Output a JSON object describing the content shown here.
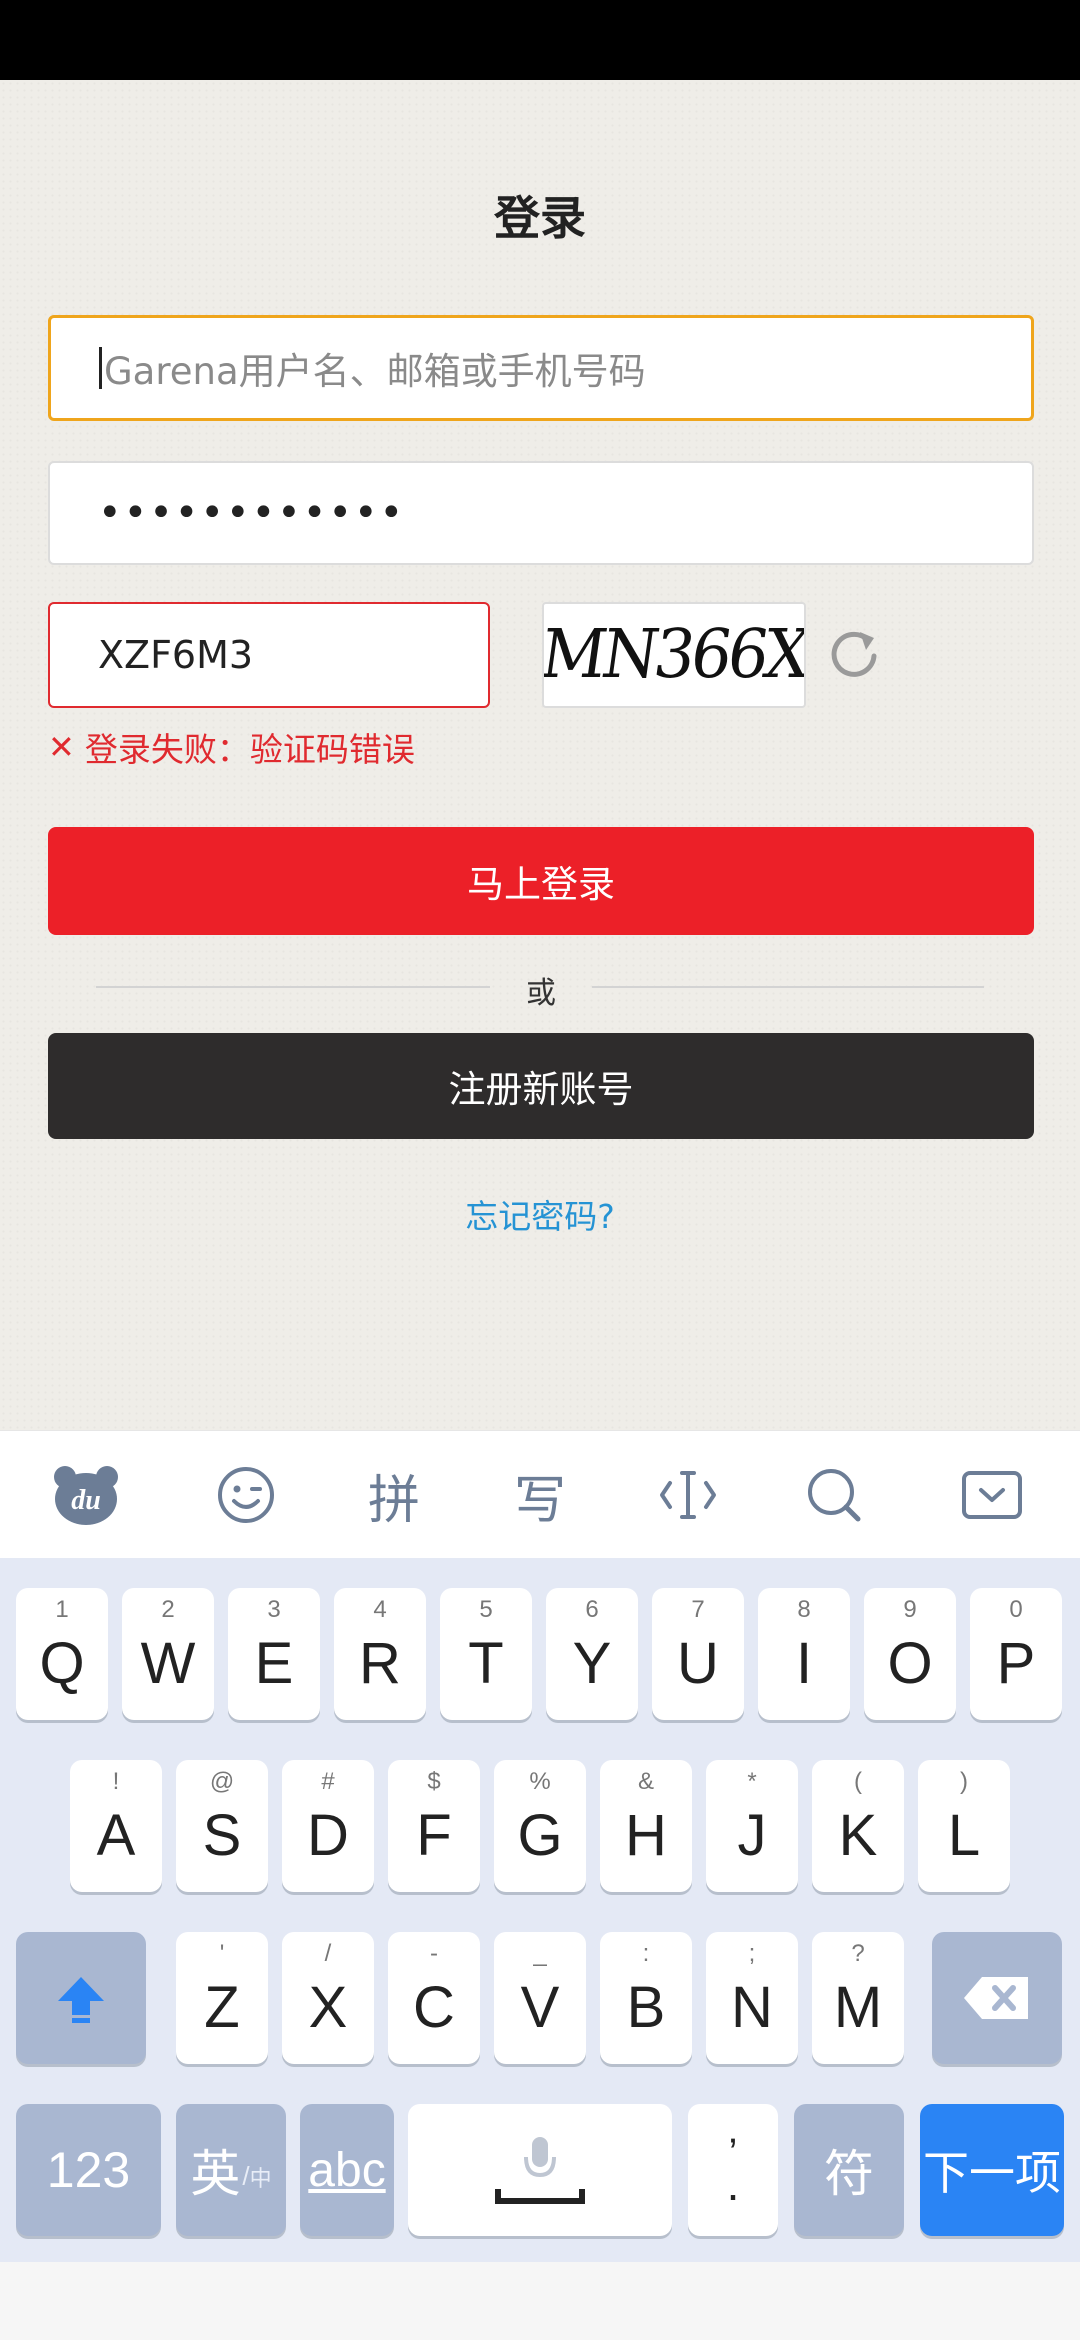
{
  "page": {
    "title": "登录",
    "username_placeholder": "Garena用户名、邮箱或手机号码",
    "password_value": "••••••••••••",
    "captcha_value": "XZF6M3",
    "captcha_image_text": "MN366X",
    "error_text": "登录失败：验证码错误",
    "login_button": "马上登录",
    "or_text": "或",
    "register_button": "注册新账号",
    "forgot_link": "忘记密码?"
  },
  "keyboard_toolbar": {
    "items": [
      "du-bear-icon",
      "emoji-icon",
      "拼",
      "写",
      "cursor-icon",
      "search-icon",
      "collapse-keyboard-icon"
    ]
  },
  "keyboard": {
    "row1": [
      {
        "k": "Q",
        "s": "1"
      },
      {
        "k": "W",
        "s": "2"
      },
      {
        "k": "E",
        "s": "3"
      },
      {
        "k": "R",
        "s": "4"
      },
      {
        "k": "T",
        "s": "5"
      },
      {
        "k": "Y",
        "s": "6"
      },
      {
        "k": "U",
        "s": "7"
      },
      {
        "k": "I",
        "s": "8"
      },
      {
        "k": "O",
        "s": "9"
      },
      {
        "k": "P",
        "s": "0"
      }
    ],
    "row2": [
      {
        "k": "A",
        "s": "!"
      },
      {
        "k": "S",
        "s": "@"
      },
      {
        "k": "D",
        "s": "#"
      },
      {
        "k": "F",
        "s": "$"
      },
      {
        "k": "G",
        "s": "%"
      },
      {
        "k": "H",
        "s": "&"
      },
      {
        "k": "J",
        "s": "*"
      },
      {
        "k": "K",
        "s": "("
      },
      {
        "k": "L",
        "s": ")"
      }
    ],
    "row3": [
      {
        "k": "Z",
        "s": "'"
      },
      {
        "k": "X",
        "s": "/"
      },
      {
        "k": "C",
        "s": "-"
      },
      {
        "k": "V",
        "s": "_"
      },
      {
        "k": "B",
        "s": ":"
      },
      {
        "k": "N",
        "s": ";"
      },
      {
        "k": "M",
        "s": "?"
      }
    ],
    "num_key": "123",
    "lang_key": "英",
    "lang_sub": "中",
    "abc_key": "abc",
    "comma_sub": "’",
    "comma_main": ".",
    "symbol_key": "符",
    "next_key": "下一项"
  },
  "colors": {
    "accent_red": "#ec2028",
    "focus_border": "#efa51c",
    "link_blue": "#2593d4",
    "next_blue": "#2a84f4"
  }
}
